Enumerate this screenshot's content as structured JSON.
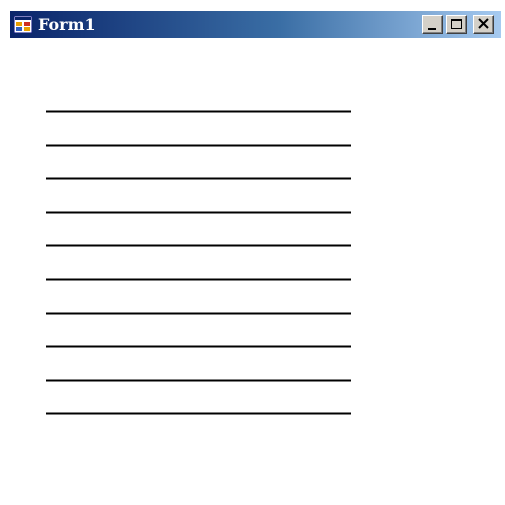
{
  "window": {
    "title": "Form1",
    "title_bar_gradient": [
      "#0a246a",
      "#3a6ea5",
      "#a6caf0"
    ],
    "caption_buttons": [
      "minimize-icon",
      "maximize-icon",
      "close-icon"
    ]
  },
  "content": {
    "line_count": 10,
    "line_color": "#000000"
  }
}
